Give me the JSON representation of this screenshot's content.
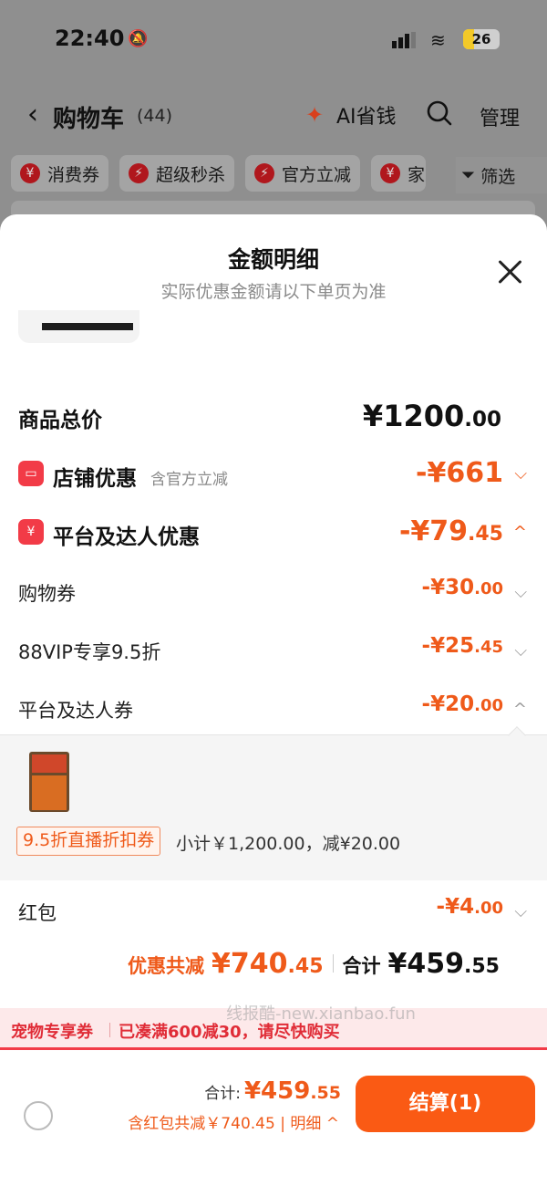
{
  "status_bar": {
    "time": "22:40",
    "battery": "26"
  },
  "nav": {
    "back_icon": "chevron-left-icon",
    "title": "购物车",
    "count": "(44)",
    "ai_label": "AI省钱",
    "manage": "管理"
  },
  "chips": [
    {
      "label": "消费券",
      "icon": "¥"
    },
    {
      "label": "超级秒杀",
      "icon": "⚡"
    },
    {
      "label": "官方立减",
      "icon": "⚡"
    },
    {
      "label": "家",
      "icon": "¥"
    }
  ],
  "filter_label": "筛选",
  "sheet": {
    "title": "金额明细",
    "subtitle": "实际优惠金额请以下单页为准"
  },
  "rows": {
    "total_price": {
      "label": "商品总价",
      "int": "¥1200",
      "dec": ".00"
    },
    "store_discount": {
      "label": "店铺优惠",
      "note": "含官方立减",
      "int": "-¥661",
      "dec": "",
      "icon": "store-icon"
    },
    "platform_discount": {
      "label": "平台及达人优惠",
      "int": "-¥79",
      "dec": ".45",
      "icon": "coupon-icon"
    },
    "shopping_coupon": {
      "label": "购物券",
      "int": "-¥30",
      "dec": ".00"
    },
    "vip_discount": {
      "label": "88VIP专享9.5折",
      "int": "-¥25",
      "dec": ".45"
    },
    "platform_coupon": {
      "label": "平台及达人券",
      "int": "-¥20",
      "dec": ".00"
    },
    "red_packet": {
      "label": "红包",
      "int": "-¥4",
      "dec": ".00"
    }
  },
  "coupon_detail": {
    "tag": "9.5折直播折扣券",
    "text": "小计￥1,200.00，减¥20.00"
  },
  "summary": {
    "discount_label": "优惠共减",
    "discount_int": "¥740",
    "discount_dec": ".45",
    "total_label": "合计",
    "total_int": "¥459",
    "total_dec": ".55"
  },
  "promo": {
    "tag": "宠物专享券",
    "text": "已凑满600减30，请尽快购买"
  },
  "watermark": "线报酷-new.xianbao.fun",
  "checkout": {
    "total_label": "合计:",
    "total_int": "¥459",
    "total_dec": ".55",
    "note": "含红包共减￥740.45 | 明细",
    "pay_label": "结算(1)"
  },
  "colors": {
    "accent": "#ef5a1a",
    "red": "#f23b47",
    "pay": "#fa5a14"
  }
}
